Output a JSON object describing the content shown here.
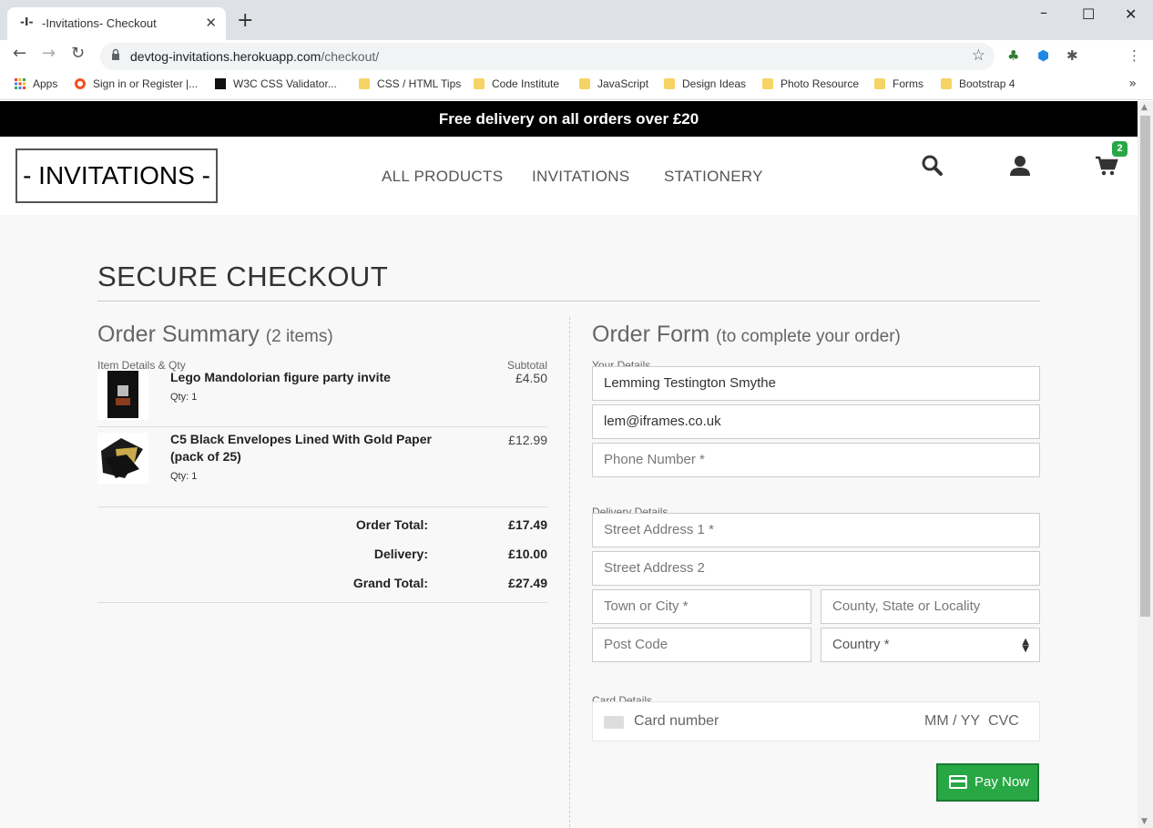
{
  "browser": {
    "tab_title": "-Invitations- Checkout",
    "favicon_text": "-I-",
    "url_host": "devtog-invitations.herokuapp.com",
    "url_path": "/checkout/",
    "bookmarks": [
      "Apps",
      "Sign in or Register |...",
      "W3C CSS Validator...",
      "CSS / HTML Tips",
      "Code Institute",
      "JavaScript",
      "Design Ideas",
      "Photo Resource",
      "Forms",
      "Bootstrap 4"
    ]
  },
  "site": {
    "banner": "Free delivery on all orders over £20",
    "logo": "- INVITATIONS -",
    "nav": [
      "ALL PRODUCTS",
      "INVITATIONS",
      "STATIONERY"
    ],
    "cart_count": "2"
  },
  "checkout": {
    "title": "SECURE CHECKOUT",
    "summary": {
      "title": "Order Summary",
      "count": "(2 items)",
      "col_item": "Item Details & Qty",
      "col_subtotal": "Subtotal",
      "items": [
        {
          "name": "Lego Mandolorian figure party invite",
          "qty": "Qty: 1",
          "price": "£4.50"
        },
        {
          "name": "C5 Black Envelopes Lined With Gold Paper (pack of 25)",
          "qty": "Qty: 1",
          "price": "£12.99"
        }
      ],
      "order_total_label": "Order Total:",
      "order_total": "£17.49",
      "delivery_label": "Delivery:",
      "delivery": "£10.00",
      "grand_total_label": "Grand Total:",
      "grand_total": "£27.49"
    },
    "form": {
      "title": "Order Form",
      "subtitle": "(to complete your order)",
      "your_details": "Your Details",
      "full_name": "Lemming Testington Smythe",
      "email": "lem@iframes.co.uk",
      "phone_placeholder": "Phone Number *",
      "delivery_details": "Delivery Details",
      "street1_placeholder": "Street Address 1 *",
      "street2_placeholder": "Street Address 2",
      "town_placeholder": "Town or City *",
      "county_placeholder": "County, State or Locality",
      "postcode_placeholder": "Post Code",
      "country_selected": "Country *",
      "card_details": "Card Details",
      "card_number_placeholder": "Card number",
      "card_expiry_placeholder": "MM / YY",
      "card_cvc_placeholder": "CVC",
      "pay_button": "Pay Now"
    }
  }
}
